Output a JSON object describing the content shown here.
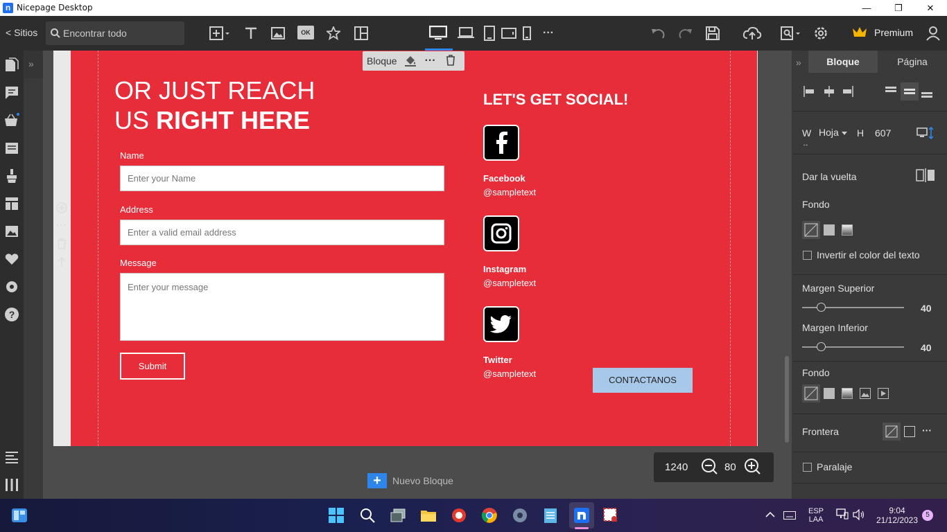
{
  "window": {
    "title": "Nicepage Desktop",
    "minimize": "—",
    "maximize": "❐",
    "close": "✕"
  },
  "toolbar": {
    "sites_label": "< Sitios",
    "search_placeholder": "Encontrar todo",
    "premium_label": "Premium",
    "more_label": "···"
  },
  "block_toolbar": {
    "label": "Bloque",
    "more_label": "···"
  },
  "section": {
    "heading_line1": "OR JUST REACH",
    "heading_line2_normal": "US ",
    "heading_line2_bold": "RIGHT HERE",
    "form": {
      "name_label": "Name",
      "name_placeholder": "Enter your Name",
      "address_label": "Address",
      "address_placeholder": "Enter a valid email address",
      "message_label": "Message",
      "message_placeholder": "Enter your message",
      "submit_label": "Submit"
    },
    "social": {
      "heading": "LET'S GET SOCIAL!",
      "items": [
        {
          "name": "Facebook",
          "handle": "@sampletext",
          "icon": "facebook-icon"
        },
        {
          "name": "Instagram",
          "handle": "@sampletext",
          "icon": "instagram-icon"
        },
        {
          "name": "Twitter",
          "handle": "@sampletext",
          "icon": "twitter-icon"
        }
      ]
    },
    "contact_button": "CONTACTANOS"
  },
  "canvas": {
    "new_block_label": "Nuevo Bloque",
    "width_value": "1240",
    "zoom_value": "80"
  },
  "right_panel": {
    "tab_block": "Bloque",
    "tab_page": "Página",
    "w_label": "W",
    "w_value": "Hoja",
    "h_label": "H",
    "h_value": "607",
    "flip_label": "Dar la vuelta",
    "background_label": "Fondo",
    "invert_text_label": "Invertir el color del texto",
    "margin_top_label": "Margen Superior",
    "margin_top_value": "40",
    "margin_bottom_label": "Margen Inferior",
    "margin_bottom_value": "40",
    "background2_label": "Fondo",
    "border_label": "Frontera",
    "border_more": "···",
    "parallax_label": "Paralaje"
  },
  "taskbar": {
    "lang_line1": "ESP",
    "lang_line2": "LAA",
    "time": "9:04",
    "date": "21/12/2023",
    "notification_count": "5"
  },
  "colors": {
    "section_bg": "#e82d3a",
    "accent": "#2f86e9",
    "premium_crown": "#f5b400",
    "contact_button_bg": "#a7c8e8"
  }
}
